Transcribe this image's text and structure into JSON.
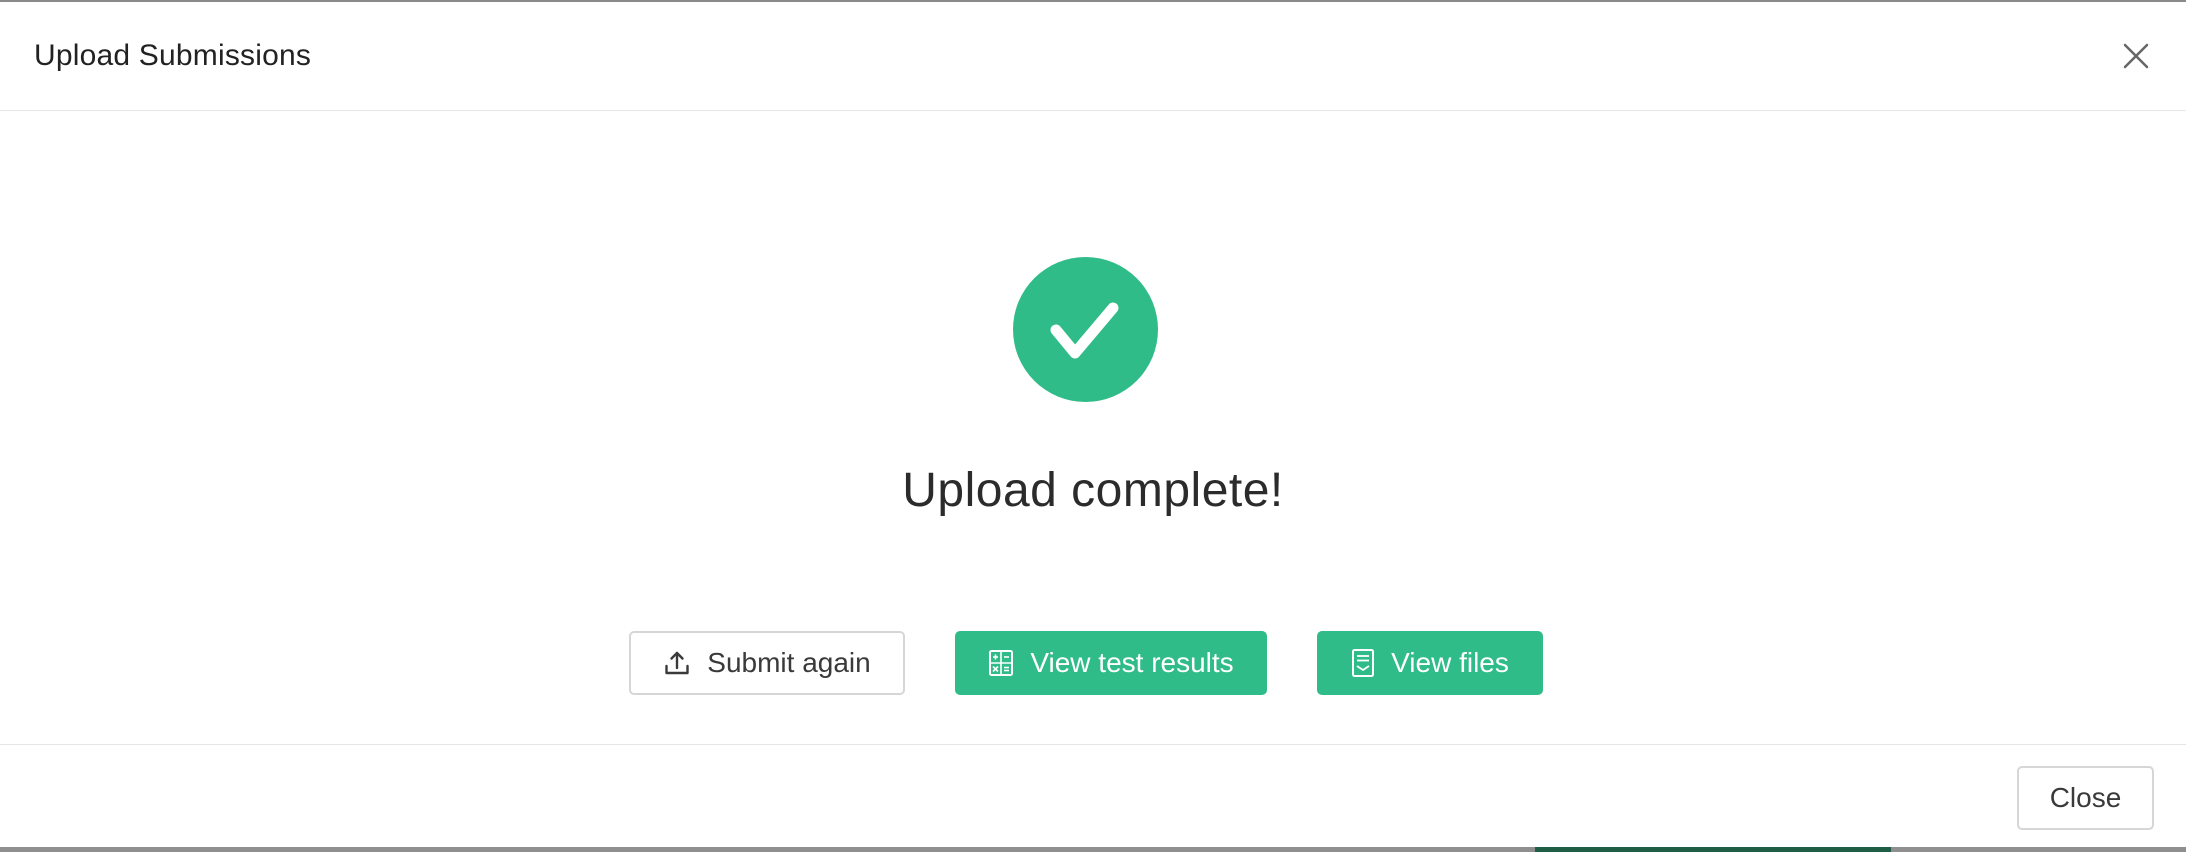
{
  "dialog": {
    "title": "Upload Submissions"
  },
  "status": {
    "message": "Upload complete!",
    "icon": "checkmark-icon"
  },
  "actions": {
    "submit_again": {
      "label": "Submit again",
      "icon": "upload-icon"
    },
    "view_test_results": {
      "label": "View test results",
      "icon": "calculator-icon"
    },
    "view_files": {
      "label": "View files",
      "icon": "document-icon"
    }
  },
  "footer": {
    "close_label": "Close"
  },
  "colors": {
    "accent": "#2fbc88",
    "text": "#2b2b2b",
    "border": "#d6d6d6"
  }
}
